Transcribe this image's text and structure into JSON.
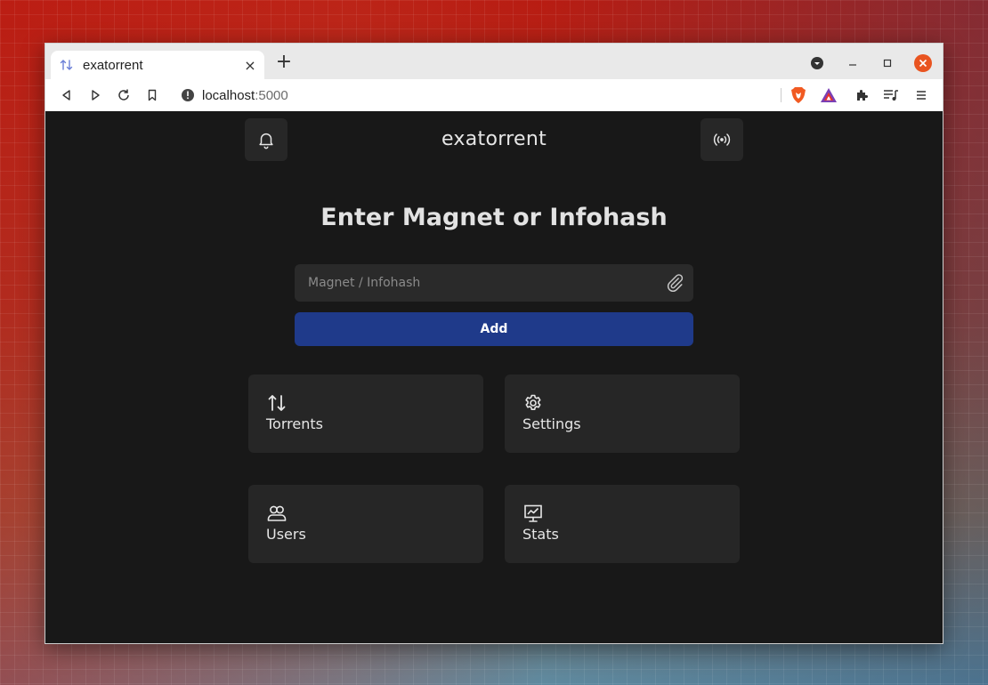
{
  "browser": {
    "tab_title": "exatorrent",
    "tab_close": "×",
    "new_tab": "+",
    "url_host": "localhost",
    "url_port": ":5000"
  },
  "app": {
    "title": "exatorrent",
    "heading": "Enter Magnet or Infohash",
    "input_placeholder": "Magnet / Infohash",
    "add_label": "Add",
    "cards": [
      {
        "label": "Torrents",
        "icon": "arrows-up-down-icon"
      },
      {
        "label": "Settings",
        "icon": "gear-icon"
      },
      {
        "label": "Users",
        "icon": "users-icon"
      },
      {
        "label": "Stats",
        "icon": "chart-icon"
      }
    ]
  },
  "colors": {
    "app_background": "#181818",
    "card_background": "#262626",
    "add_button": "#1f3a8a",
    "close_button": "#e95420"
  }
}
